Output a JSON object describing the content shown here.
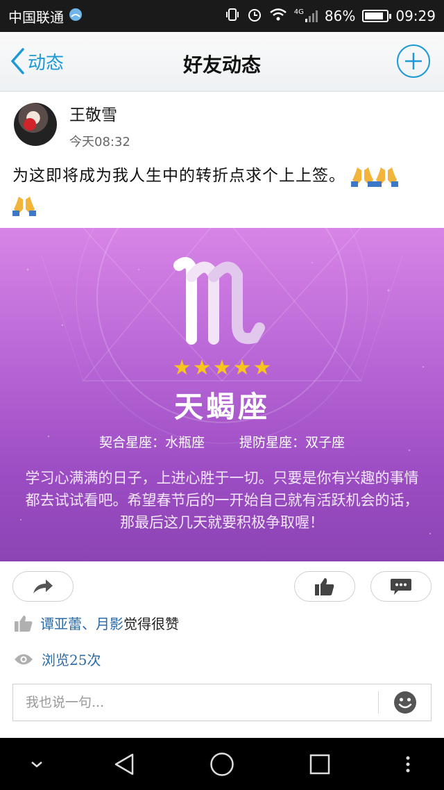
{
  "status_bar": {
    "carrier": "中国联通",
    "network": "4G",
    "battery": "86%",
    "battery_level": 0.86,
    "time": "09:29"
  },
  "nav": {
    "back_label": "动态",
    "title": "好友动态"
  },
  "post": {
    "author": "王敬雪",
    "time": "今天08:32",
    "text": "为这即将成为我人生中的转折点求个上上签。",
    "emoji": [
      "folded-hands",
      "folded-hands",
      "folded-hands"
    ]
  },
  "horoscope": {
    "sign_glyph": "scorpio-glyph",
    "stars": 5,
    "sign_name": "天蝎座",
    "match": "契合星座：水瓶座",
    "beware": "提防星座：双子座",
    "description": "学习心满满的日子，上进心胜于一切。只要是你有兴趣的事情都去试试看吧。希望春节后的一开始自己就有活跃机会的话，那最后这几天就要积极争取喔！"
  },
  "interactions": {
    "liked_by": "谭亚蕾、月影",
    "liked_suffix": "觉得很赞",
    "views": "浏览25次"
  },
  "comment": {
    "placeholder": "我也说一句..."
  },
  "colors": {
    "accent": "#1d9ad6",
    "link": "#2a6aa6",
    "star": "#f8c51c",
    "card_top": "#d785e6",
    "card_bottom": "#8c44b4"
  }
}
